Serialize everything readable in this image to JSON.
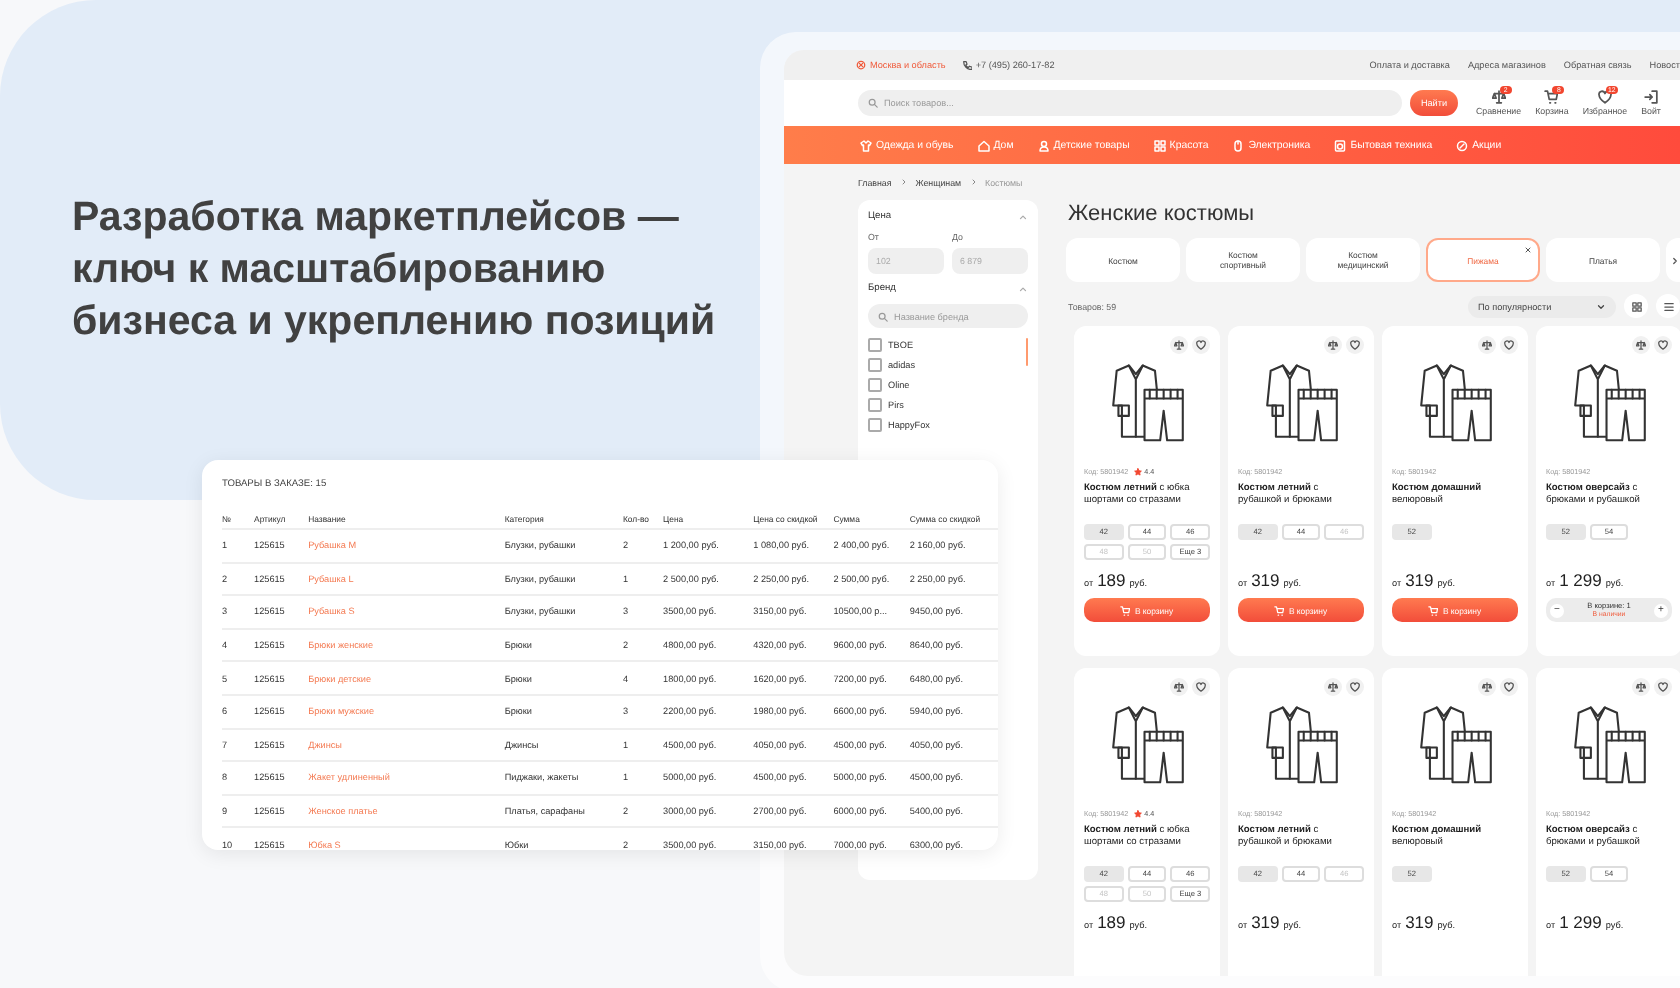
{
  "headline": "Разработка маркетплейсов — ключ к масштабированию бизнеса и укреплению позиций",
  "top_bar": {
    "location": "Москва и область",
    "phone": "+7 (495) 260-17-82",
    "links": [
      "Оплата и доставка",
      "Адреса магазинов",
      "Обратная связь",
      "Новост"
    ]
  },
  "search": {
    "placeholder": "Поиск товаров...",
    "button": "Найти"
  },
  "header_actions": [
    {
      "kind": "compare",
      "label": "Сравнение",
      "badge": "2"
    },
    {
      "kind": "cart",
      "label": "Корзина",
      "badge": "8"
    },
    {
      "kind": "favorites",
      "label": "Избранное",
      "badge": "12"
    },
    {
      "kind": "login",
      "label": "Войт"
    }
  ],
  "categories": [
    {
      "kind": "clothes",
      "label": "Одежда и обувь"
    },
    {
      "kind": "home",
      "label": "Дом"
    },
    {
      "kind": "kids",
      "label": "Детские товары"
    },
    {
      "kind": "beauty",
      "label": "Красота"
    },
    {
      "kind": "electronics",
      "label": "Электроника"
    },
    {
      "kind": "appliances",
      "label": "Бытовая техника"
    },
    {
      "kind": "sale",
      "label": "Акции"
    }
  ],
  "breadcrumbs": [
    "Главная",
    "Женщинам",
    "Костюмы"
  ],
  "filters": {
    "price": {
      "title": "Цена",
      "from_label": "От",
      "to_label": "До",
      "from_placeholder": "102",
      "to_placeholder": "6 879"
    },
    "brand": {
      "title": "Бренд",
      "placeholder": "Название бренда",
      "options": [
        {
          "label": "TBOE",
          "checked": false
        },
        {
          "label": "adidas",
          "checked": false
        },
        {
          "label": "Oline",
          "checked": false
        },
        {
          "label": "Pirs",
          "checked": false
        },
        {
          "label": "HappyFox",
          "checked": false
        }
      ]
    }
  },
  "page_title": "Женские костюмы",
  "chips": [
    {
      "label": "Костюм",
      "selected": false
    },
    {
      "label": "Костюм спортивный",
      "selected": false
    },
    {
      "label": "Костюм медицинский",
      "selected": false
    },
    {
      "label": "Пижама",
      "selected": true
    },
    {
      "label": "Платья",
      "selected": false
    }
  ],
  "product_count": "Товаров: 59",
  "sort": "По популярности",
  "products": [
    {
      "code": "Код: 5801942",
      "rating": "4.4",
      "title": "**Костюм летний** с юбка шортами со стразами",
      "sizes": [
        {
          "label": "42",
          "selected": true,
          "disabled": false
        },
        {
          "label": "44",
          "selected": false,
          "disabled": false
        },
        {
          "label": "46",
          "selected": false,
          "disabled": false
        },
        {
          "label": "48",
          "selected": false,
          "disabled": true
        },
        {
          "label": "50",
          "selected": false,
          "disabled": true
        },
        {
          "label": "Еще 3",
          "selected": false,
          "disabled": false
        }
      ],
      "price_prefix": "от",
      "price": "189",
      "currency": "руб.",
      "cart": {
        "kind": "button",
        "label": "В корзину"
      }
    },
    {
      "code": "Код: 5801942",
      "title": "**Костюм летний** с рубашкой и брюками",
      "sizes": [
        {
          "label": "42",
          "selected": true,
          "disabled": false
        },
        {
          "label": "44",
          "selected": false,
          "disabled": false
        },
        {
          "label": "46",
          "selected": false,
          "disabled": true
        }
      ],
      "price_prefix": "от",
      "price": "319",
      "currency": "руб.",
      "cart": {
        "kind": "button",
        "label": "В корзину"
      }
    },
    {
      "code": "Код: 5801942",
      "title": "**Костюм домашний** велюровый",
      "sizes": [
        {
          "label": "52",
          "selected": true,
          "disabled": false
        }
      ],
      "price_prefix": "от",
      "price": "319",
      "currency": "руб.",
      "cart": {
        "kind": "button",
        "label": "В корзину"
      }
    },
    {
      "code": "Код: 5801942",
      "title": "**Костюм оверсайз** с брюками и рубашкой",
      "sizes": [
        {
          "label": "52",
          "selected": true,
          "disabled": false
        },
        {
          "label": "54",
          "selected": false,
          "disabled": false
        }
      ],
      "price_prefix": "от",
      "price": "1 299",
      "currency": "руб.",
      "cart": {
        "kind": "stepper",
        "decrement": "−",
        "label": "В корзине: 1",
        "status": "В наличии",
        "increment": "+"
      }
    },
    {
      "code": "Код: 5801942",
      "rating": "4.4",
      "title": "**Костюм летний** с юбка шортами со стразами",
      "sizes": [
        {
          "label": "42",
          "selected": true,
          "disabled": false
        },
        {
          "label": "44",
          "selected": false,
          "disabled": false
        },
        {
          "label": "46",
          "selected": false,
          "disabled": false
        },
        {
          "label": "48",
          "selected": false,
          "disabled": true
        },
        {
          "label": "50",
          "selected": false,
          "disabled": true
        },
        {
          "label": "Еще 3",
          "selected": false,
          "disabled": false
        }
      ],
      "price_prefix": "от",
      "price": "189",
      "currency": "руб."
    },
    {
      "code": "Код: 5801942",
      "title": "**Костюм летний** с рубашкой и брюками",
      "sizes": [
        {
          "label": "42",
          "selected": true,
          "disabled": false
        },
        {
          "label": "44",
          "selected": false,
          "disabled": false
        },
        {
          "label": "46",
          "selected": false,
          "disabled": true
        }
      ],
      "price_prefix": "от",
      "price": "319",
      "currency": "руб."
    },
    {
      "code": "Код: 5801942",
      "title": "**Костюм домашний** велюровый",
      "sizes": [
        {
          "label": "52",
          "selected": true,
          "disabled": false
        }
      ],
      "price_prefix": "от",
      "price": "319",
      "currency": "руб."
    },
    {
      "code": "Код: 5801942",
      "title": "**Костюм оверсайз** с брюками и рубашкой",
      "sizes": [
        {
          "label": "52",
          "selected": true,
          "disabled": false
        },
        {
          "label": "54",
          "selected": false,
          "disabled": false
        }
      ],
      "price_prefix": "от",
      "price": "1 299",
      "currency": "руб."
    }
  ],
  "order_table": {
    "title": "ТОВАРЫ В ЗАКАЗЕ: 15",
    "columns": [
      "№",
      "Артикул",
      "Название",
      "Категория",
      "Кол-во",
      "Цена",
      "Цена со скидкой",
      "Сумма",
      "Сумма со скидкой"
    ],
    "rows": [
      [
        "1",
        "125615",
        "Рубашка M",
        "Блузки, рубашки",
        "2",
        "1 200,00 руб.",
        "1 080,00 руб.",
        "2 400,00 руб.",
        "2 160,00 руб."
      ],
      [
        "2",
        "125615",
        "Рубашка L",
        "Блузки, рубашки",
        "1",
        "2 500,00 руб.",
        "2 250,00 руб.",
        "2 500,00 руб.",
        "2 250,00 руб."
      ],
      [
        "3",
        "125615",
        "Рубашка S",
        "Блузки, рубашки",
        "3",
        "3500,00 руб.",
        "3150,00 руб.",
        "10500,00 р...",
        "9450,00 руб."
      ],
      [
        "4",
        "125615",
        "Брюки женские",
        "Брюки",
        "2",
        "4800,00 руб.",
        "4320,00 руб.",
        "9600,00 руб.",
        "8640,00 руб."
      ],
      [
        "5",
        "125615",
        "Брюки детские",
        "Брюки",
        "4",
        "1800,00 руб.",
        "1620,00 руб.",
        "7200,00 руб.",
        "6480,00 руб."
      ],
      [
        "6",
        "125615",
        "Брюки мужские",
        "Брюки",
        "3",
        "2200,00 руб.",
        "1980,00 руб.",
        "6600,00 руб.",
        "5940,00 руб."
      ],
      [
        "7",
        "125615",
        "Джинсы",
        "Джинсы",
        "1",
        "4500,00 руб.",
        "4050,00 руб.",
        "4500,00 руб.",
        "4050,00 руб."
      ],
      [
        "8",
        "125615",
        "Жакет удлиненный",
        "Пиджаки, жакеты",
        "1",
        "5000,00 руб.",
        "4500,00 руб.",
        "5000,00 руб.",
        "4500,00 руб."
      ],
      [
        "9",
        "125615",
        "Женское платье",
        "Платья, сарафаны",
        "2",
        "3000,00 руб.",
        "2700,00 руб.",
        "6000,00 руб.",
        "5400,00 руб."
      ],
      [
        "10",
        "125615",
        "Юбка S",
        "Юбки",
        "2",
        "3500,00 руб.",
        "3150,00 руб.",
        "7000,00 руб.",
        "6300,00 руб."
      ]
    ]
  }
}
